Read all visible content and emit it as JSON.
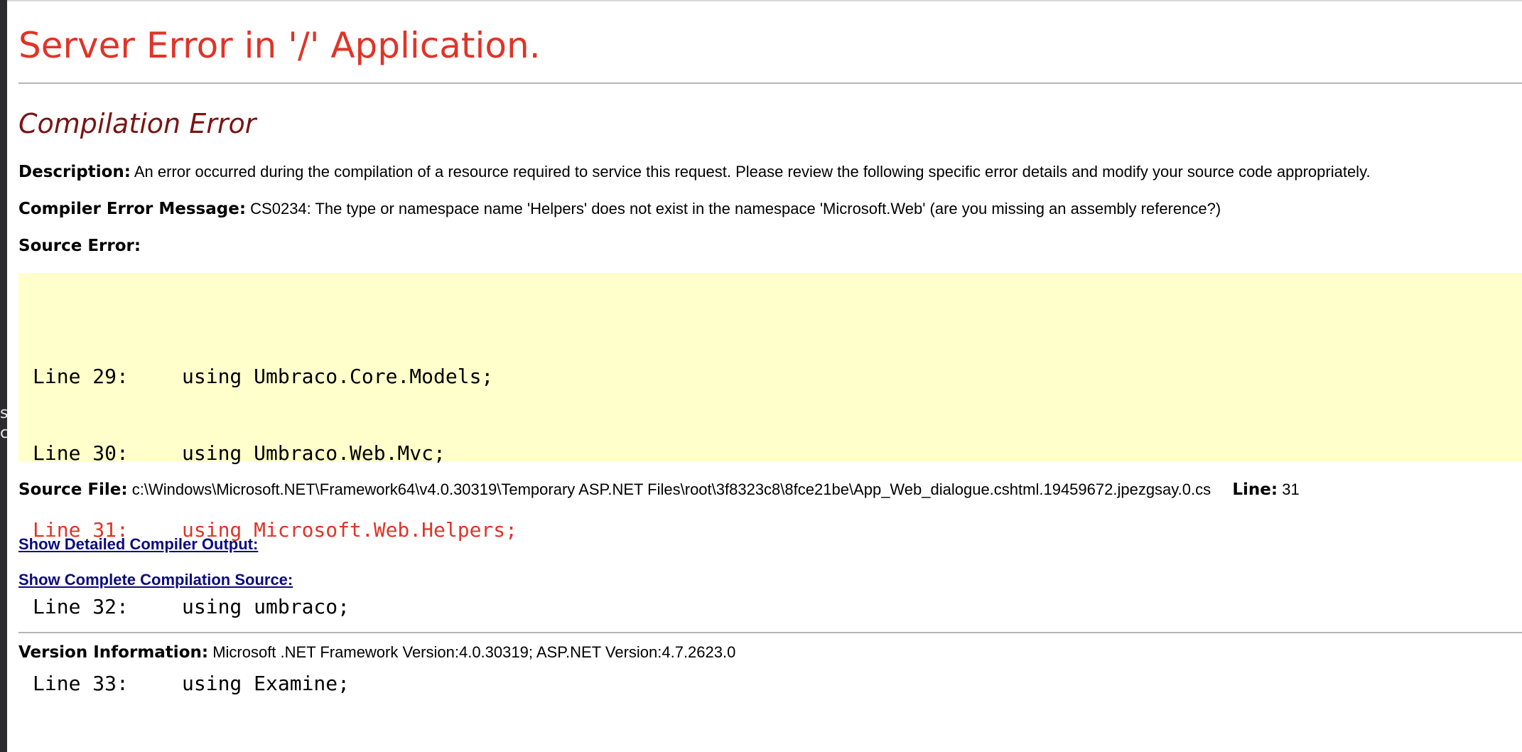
{
  "left_strip": {
    "chars": [
      "s",
      "c"
    ]
  },
  "header": {
    "title": "Server Error in '/' Application."
  },
  "error": {
    "type": "Compilation Error",
    "description_label": "Description:",
    "description_text": "An error occurred during the compilation of a resource required to service this request. Please review the following specific error details and modify your source code appropriately.",
    "message_label": "Compiler Error Message:",
    "message_text": "CS0234: The type or namespace name 'Helpers' does not exist in the namespace 'Microsoft.Web' (are you missing an assembly reference?)",
    "source_error_label": "Source Error:"
  },
  "source_code": {
    "lines": [
      {
        "number": "Line 29:",
        "code": "using Umbraco.Core.Models;",
        "highlight": false
      },
      {
        "number": "Line 30:",
        "code": "using Umbraco.Web.Mvc;",
        "highlight": false
      },
      {
        "number": "Line 31:",
        "code": "using Microsoft.Web.Helpers;",
        "highlight": true
      },
      {
        "number": "Line 32:",
        "code": "using umbraco;",
        "highlight": false
      },
      {
        "number": "Line 33:",
        "code": "using Examine;",
        "highlight": false
      }
    ],
    "highlight_color": "#e03427",
    "background_color": "#ffffcc"
  },
  "source_file": {
    "label": "Source File:",
    "path": "c:\\Windows\\Microsoft.NET\\Framework64\\v4.0.30319\\Temporary ASP.NET Files\\root\\3f8323c8\\8fce21be\\App_Web_dialogue.cshtml.19459672.jpezgsay.0.cs",
    "line_label": "Line:",
    "line_value": "31"
  },
  "links": {
    "compiler_output": "Show Detailed Compiler Output:",
    "compilation_source": "Show Complete Compilation Source:"
  },
  "version": {
    "label": "Version Information:",
    "text": "Microsoft .NET Framework Version:4.0.30319; ASP.NET Version:4.7.2623.0"
  },
  "colors": {
    "title": "#e03427",
    "error_type": "#7a1414",
    "link": "#0b0b80"
  }
}
